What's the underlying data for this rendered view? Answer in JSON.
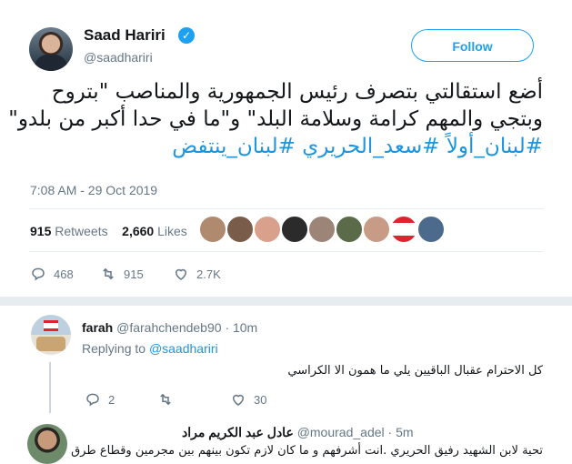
{
  "tweet": {
    "author_name": "Saad Hariri",
    "author_handle": "@saadhariri",
    "follow_label": "Follow",
    "text_line1": "أضع استقالتي بتصرف رئيس الجمهورية والمناصب \"بتروح",
    "text_line2": "وبتجي والمهم كرامة وسلامة البلد\" و\"ما في حدا أكبر من بلدو\"",
    "hashtags_line": "#لبنان_أولاً #سعد_الحريري #لبنان_ينتفض",
    "timestamp": "7:08 AM - 29 Oct 2019",
    "retweets_count": "915",
    "retweets_label": "Retweets",
    "likes_count": "2,660",
    "likes_label": "Likes",
    "actions": {
      "replies": "468",
      "retweets": "915",
      "likes": "2.7K"
    }
  },
  "replies": [
    {
      "name": "farah",
      "handle": "@farahchendeb90",
      "time": "· 10m",
      "replying_prefix": "Replying to",
      "replying_to": "@saadhariri",
      "text": "كل الاحترام عقبال الباقيين يلي ما همون الا الكراسي",
      "actions": {
        "replies": "2",
        "retweets": "",
        "likes": "30"
      }
    },
    {
      "name": "عادل عبد الكريم مراد",
      "handle": "@mourad_adel",
      "time": "· 5m",
      "text": "تحية لابن الشهيد رفيق الحريري .انت أشرفهم و ما كان لازم تكون بينهم بين مجرمين وقطاع طرق"
    }
  ],
  "colors": {
    "accent": "#1da1f2",
    "link": "#1b95e0",
    "muted": "#657786",
    "divider": "#e6ecf0"
  }
}
